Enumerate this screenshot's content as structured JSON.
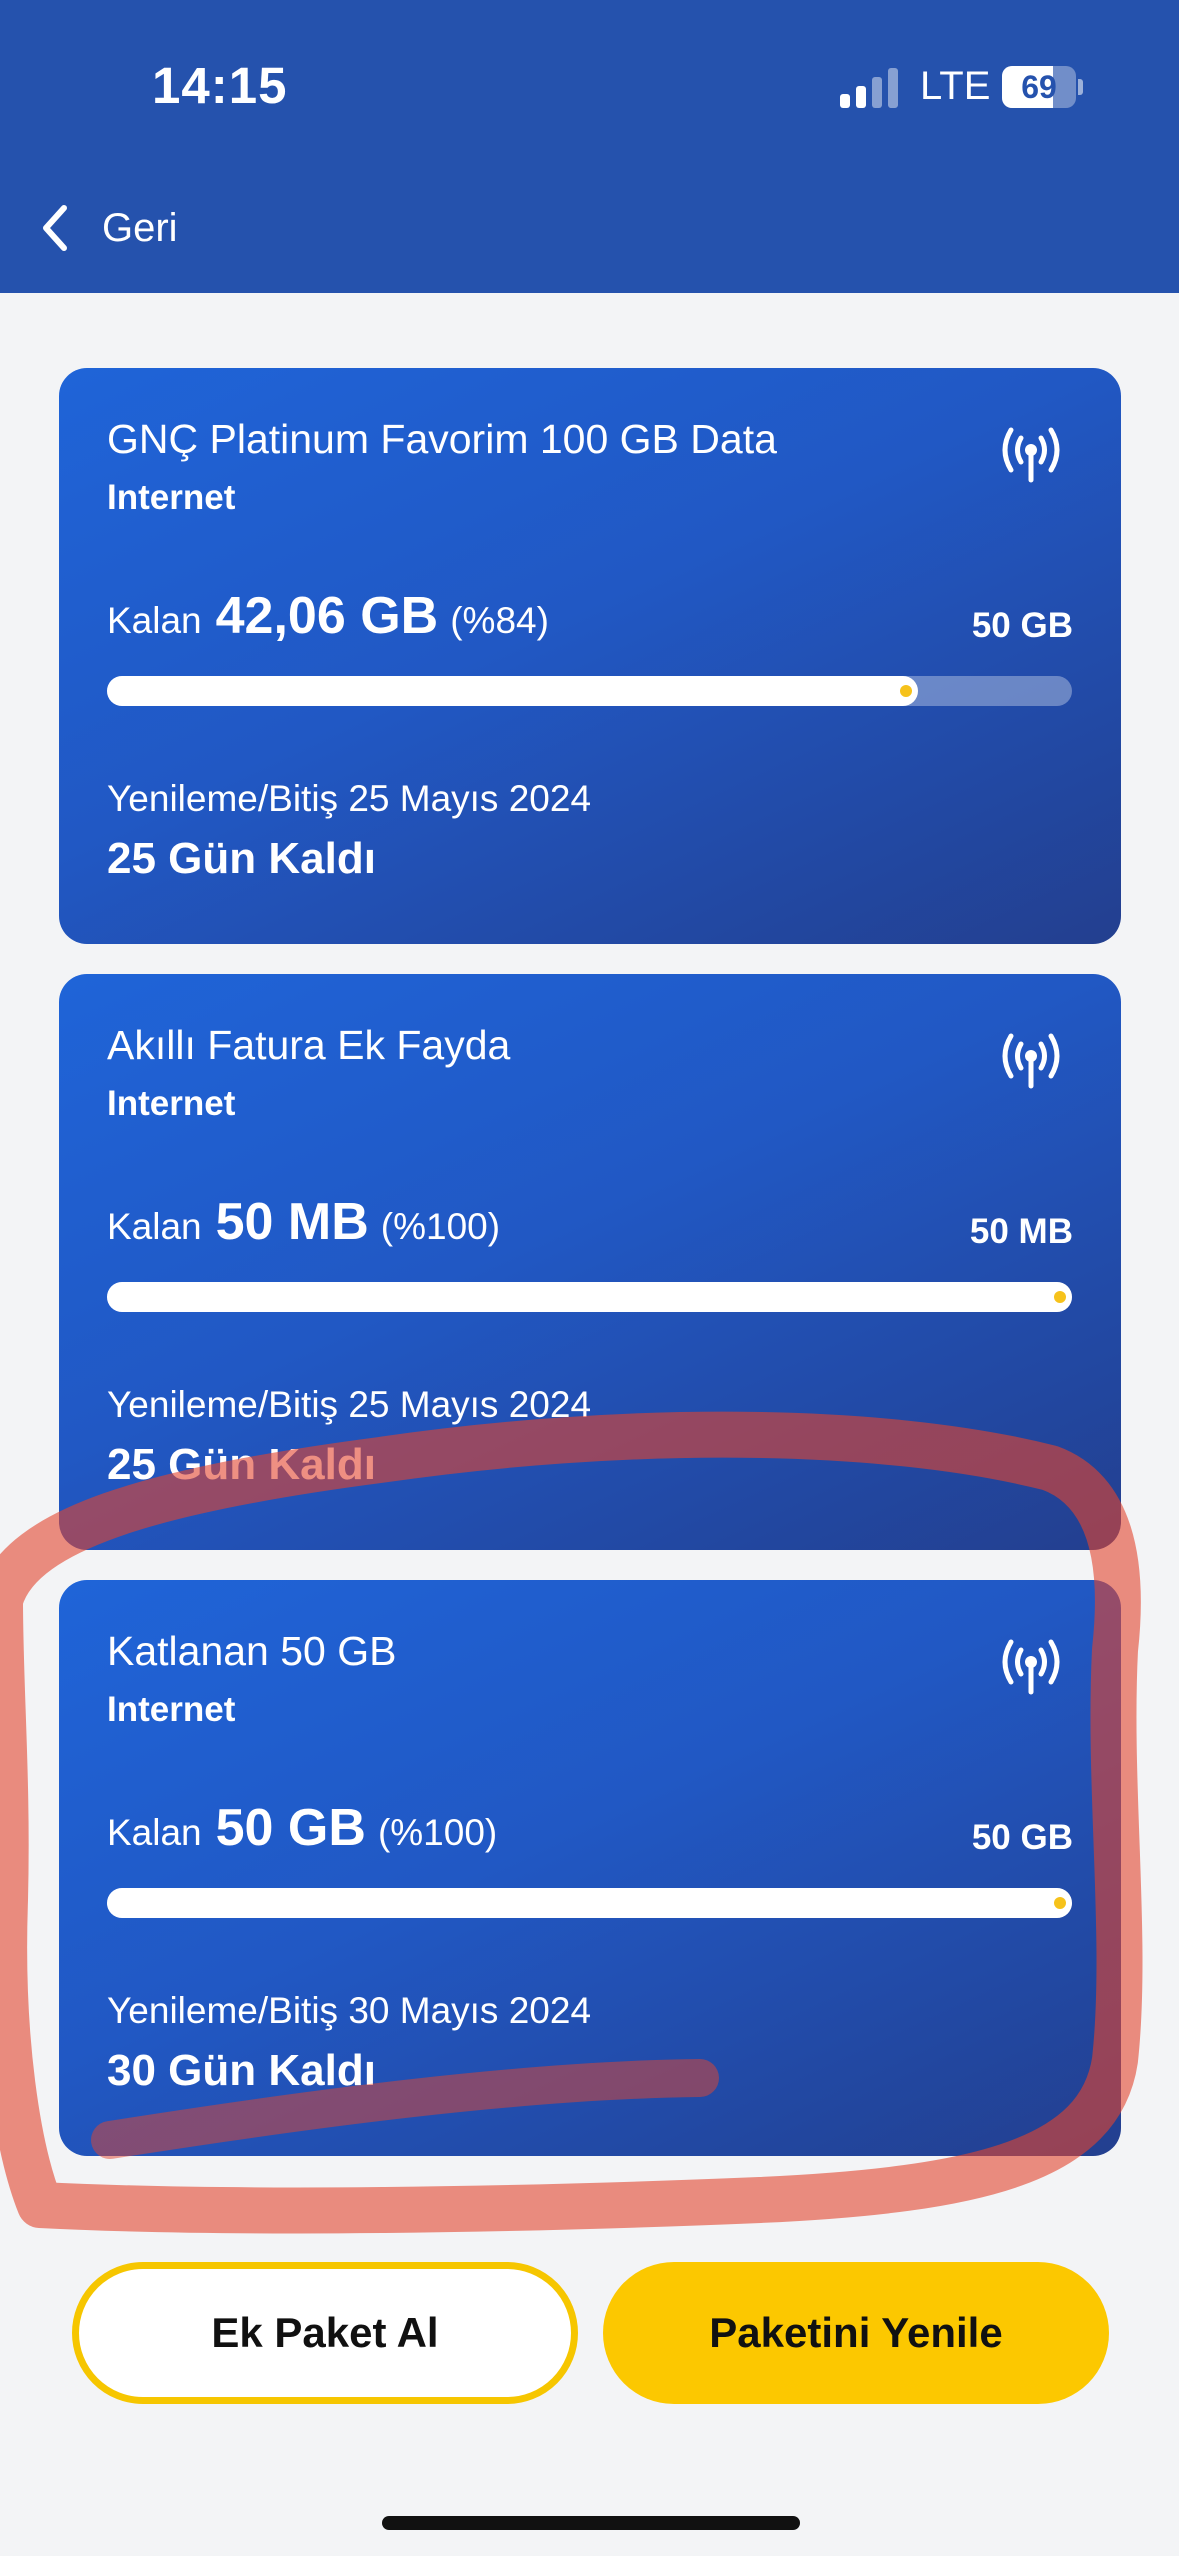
{
  "status_bar": {
    "time": "14:15",
    "network": "LTE",
    "battery": "69",
    "battery_level": 0.69
  },
  "nav": {
    "back_label": "Geri"
  },
  "packages": [
    {
      "title": "GNÇ Platinum Favorim 100 GB Data",
      "type": "Internet",
      "remaining_label": "Kalan",
      "remaining_value": "42,06 GB",
      "remaining_percent": "(%84)",
      "total": "50 GB",
      "progress": 0.84,
      "renewal": "Yenileme/Bitiş 25 Mayıs 2024",
      "days_left": "25 Gün Kaldı"
    },
    {
      "title": "Akıllı Fatura Ek Fayda",
      "type": "Internet",
      "remaining_label": "Kalan",
      "remaining_value": "50 MB",
      "remaining_percent": "(%100)",
      "total": "50 MB",
      "progress": 1.0,
      "renewal": "Yenileme/Bitiş 25 Mayıs 2024",
      "days_left": "25 Gün Kaldı"
    },
    {
      "title": "Katlanan 50 GB",
      "type": "Internet",
      "remaining_label": "Kalan",
      "remaining_value": "50 GB",
      "remaining_percent": "(%100)",
      "total": "50 GB",
      "progress": 1.0,
      "renewal": "Yenileme/Bitiş 30 Mayıs 2024",
      "days_left": "30 Gün Kaldı"
    }
  ],
  "actions": {
    "buy_addon": "Ek Paket Al",
    "renew_package": "Paketini Yenile"
  },
  "colors": {
    "header": "#2552ad",
    "accent": "#fcc800",
    "annotation": "#e2452f"
  }
}
